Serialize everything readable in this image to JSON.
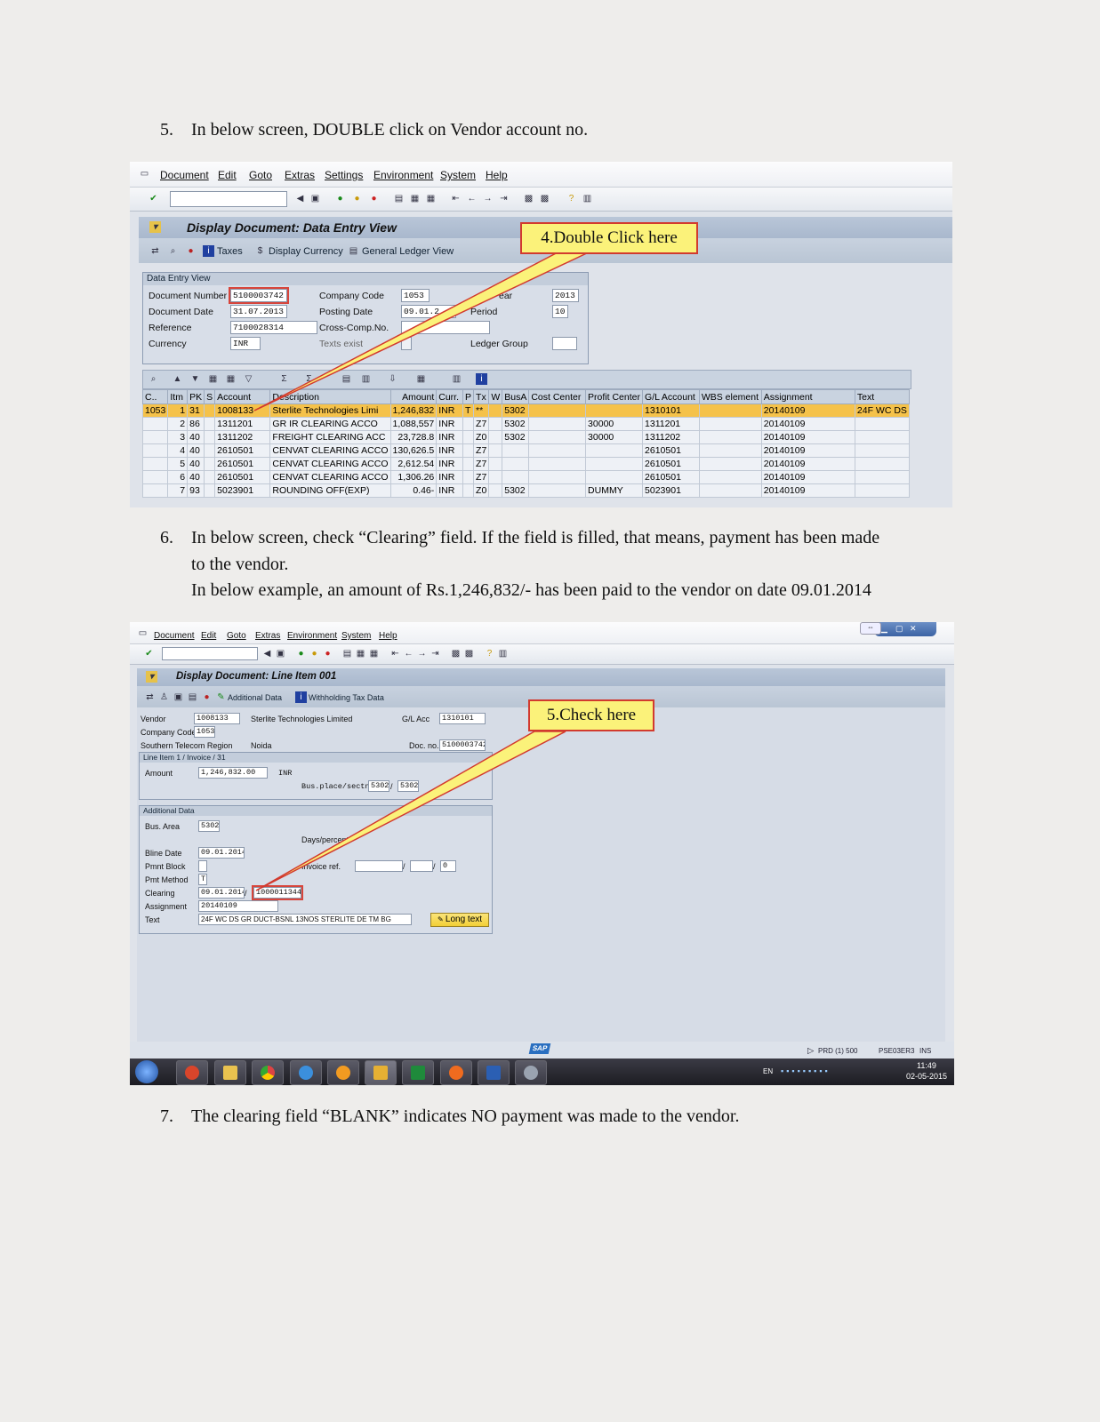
{
  "steps": {
    "s5": {
      "num": "5.",
      "text": "In below screen, DOUBLE click on Vendor account no."
    },
    "s6": {
      "num": "6.",
      "line1": "In below screen, check “Clearing” field. If the field is filled, that means, payment has been made",
      "line2": "to the vendor.",
      "line3": "In below example, an amount of Rs.1,246,832/- has been paid to the vendor on date 09.01.2014"
    },
    "s7": {
      "num": "7.",
      "text": "The clearing field “BLANK” indicates NO payment was made to the vendor."
    }
  },
  "menu": [
    "Document",
    "Edit",
    "Goto",
    "Extras",
    "Settings",
    "Environment",
    "System",
    "Help"
  ],
  "menu2": [
    "Document",
    "Edit",
    "Goto",
    "Extras",
    "Environment",
    "System",
    "Help"
  ],
  "screen1": {
    "title": "Display Document: Data Entry View",
    "app_buttons": {
      "taxes": "Taxes",
      "display_currency": "Display Currency",
      "gl_view": "General Ledger View"
    },
    "callout": "4.Double Click here",
    "panel_title": "Data Entry View",
    "fields": {
      "doc_number_label": "Document Number",
      "doc_number": "5100003742",
      "company_code_label": "Company Code",
      "company_code": "1053",
      "fiscal_year_label": "ear",
      "fiscal_year": "2013",
      "doc_date_label": "Document Date",
      "doc_date": "31.07.2013",
      "posting_date_label": "Posting Date",
      "posting_date": "09.01.2",
      "period_label": "Period",
      "period": "10",
      "reference_label": "Reference",
      "reference": "7100028314",
      "cross_comp_label": "Cross-Comp.No.",
      "cross_comp": "",
      "currency_label": "Currency",
      "currency": "INR",
      "texts_exist_label": "Texts exist",
      "ledger_group_label": "Ledger Group",
      "ledger_group": ""
    },
    "columns": [
      "C..",
      "Itm",
      "PK",
      "S",
      "Account",
      "Description",
      "Amount",
      "Curr.",
      "P",
      "Tx",
      "W",
      "BusA",
      "Cost Center",
      "Profit Center",
      "G/L Account",
      "WBS element",
      "Assignment",
      "Text"
    ],
    "rows": [
      [
        "1053",
        "1",
        "31",
        "",
        "1008133",
        "Sterlite Technologies Limi",
        "1,246,832",
        "INR",
        "T",
        "**",
        "",
        "5302",
        "",
        "",
        "1310101",
        "",
        "20140109",
        "24F WC DS"
      ],
      [
        "",
        "2",
        "86",
        "",
        "1311201",
        "GR IR CLEARING ACCO",
        "1,088,557",
        "INR",
        "",
        "Z7",
        "",
        "5302",
        "",
        "30000",
        "1311201",
        "",
        "20140109",
        ""
      ],
      [
        "",
        "3",
        "40",
        "",
        "1311202",
        "FREIGHT CLEARING ACC",
        "23,728.8",
        "INR",
        "",
        "Z0",
        "",
        "5302",
        "",
        "30000",
        "1311202",
        "",
        "20140109",
        ""
      ],
      [
        "",
        "4",
        "40",
        "",
        "2610501",
        "CENVAT CLEARING ACCO",
        "130,626.5",
        "INR",
        "",
        "Z7",
        "",
        "",
        "",
        "",
        "2610501",
        "",
        "20140109",
        ""
      ],
      [
        "",
        "5",
        "40",
        "",
        "2610501",
        "CENVAT CLEARING ACCO",
        "2,612.54",
        "INR",
        "",
        "Z7",
        "",
        "",
        "",
        "",
        "2610501",
        "",
        "20140109",
        ""
      ],
      [
        "",
        "6",
        "40",
        "",
        "2610501",
        "CENVAT CLEARING ACCO",
        "1,306.26",
        "INR",
        "",
        "Z7",
        "",
        "",
        "",
        "",
        "2610501",
        "",
        "20140109",
        ""
      ],
      [
        "",
        "7",
        "93",
        "",
        "5023901",
        "ROUNDING OFF(EXP)",
        "0.46-",
        "INR",
        "",
        "Z0",
        "",
        "5302",
        "",
        "DUMMY",
        "5023901",
        "",
        "20140109",
        ""
      ]
    ]
  },
  "screen2": {
    "title": "Display Document: Line Item 001",
    "app_buttons": {
      "additional_data": "Additional Data",
      "withholding": "Withholding Tax Data"
    },
    "callout": "5.Check here",
    "vendor_label": "Vendor",
    "vendor": "1008133",
    "vendor_name": "Sterlite Technologies Limited",
    "gl_acc_label": "G/L Acc",
    "gl_acc": "1310101",
    "company_code_label": "Company Code",
    "company_code": "1053",
    "region": "Southern Telecom Region",
    "city": "Noida",
    "doc_no_label": "Doc. no.",
    "doc_no": "5100003742",
    "line_panel_title": "Line Item 1 / Invoice / 31",
    "amount_label": "Amount",
    "amount": "1,246,832.00",
    "currency": "INR",
    "bus_place_label": "Bus.place/sectn",
    "bus_place": "5302",
    "bus_sect": "5302",
    "add_panel_title": "Additional Data",
    "bus_area_label": "Bus. Area",
    "bus_area": "5302",
    "days_label": "Days/percent",
    "bline_label": "Bline Date",
    "bline": "09.01.2014",
    "pmnt_block_label": "Pmnt Block",
    "pmnt_block": "",
    "invoice_ref_label": "Invoice ref.",
    "invoice_ref_3": "0",
    "pmt_method_label": "Pmt Method",
    "pmt_method": "T",
    "clearing_label": "Clearing",
    "clearing_date": "09.01.2014",
    "clearing_doc": "1000011344",
    "assignment_label": "Assignment",
    "assignment": "20140109",
    "text_label": "Text",
    "text": "24F WC DS GR DUCT-BSNL 13NOS STERLITE DE TM BG",
    "long_text": "Long text",
    "status": "PRD (1) 500",
    "status2": "PSE03ER3",
    "status3": "INS",
    "sap_logo": "SAP",
    "tray_lang": "EN",
    "clock_time": "11:49",
    "clock_date": "02-05-2015"
  }
}
